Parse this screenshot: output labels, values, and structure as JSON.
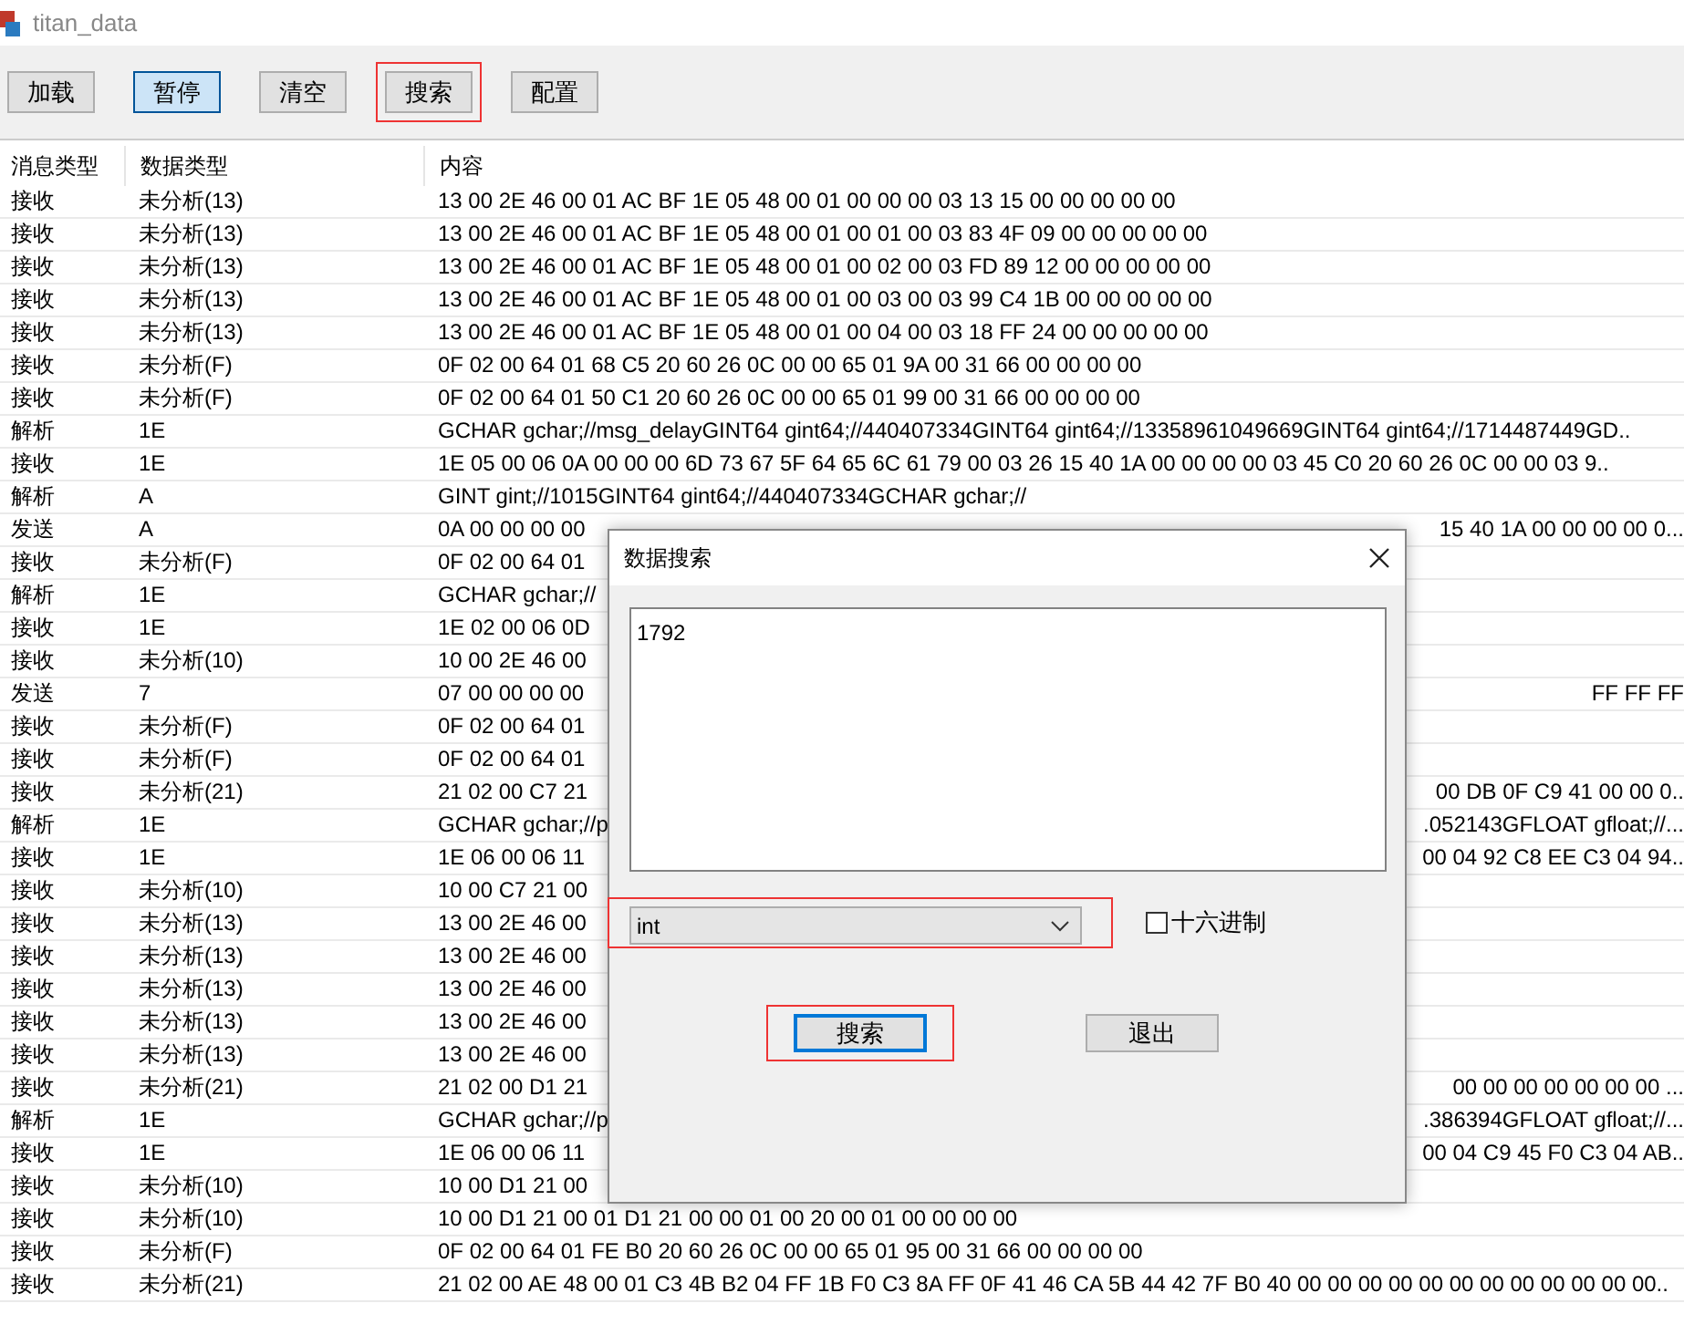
{
  "window": {
    "title": "titan_data"
  },
  "toolbar": [
    {
      "label": "加载",
      "active": false,
      "highlighted": false
    },
    {
      "label": "暂停",
      "active": true,
      "highlighted": false
    },
    {
      "label": "清空",
      "active": false,
      "highlighted": false
    },
    {
      "label": "搜索",
      "active": false,
      "highlighted": true
    },
    {
      "label": "配置",
      "active": false,
      "highlighted": false
    }
  ],
  "table": {
    "columns": [
      "消息类型",
      "数据类型",
      "内容"
    ],
    "rows": [
      {
        "message_type": "接收",
        "data_type": "未分析(13)",
        "content": "13 00 2E 46 00 01 AC BF 1E 05 48 00 01 00 00 00 03 13 15 00 00 00 00 00"
      },
      {
        "message_type": "接收",
        "data_type": "未分析(13)",
        "content": "13 00 2E 46 00 01 AC BF 1E 05 48 00 01 00 01 00 03 83 4F 09 00 00 00 00 00"
      },
      {
        "message_type": "接收",
        "data_type": "未分析(13)",
        "content": "13 00 2E 46 00 01 AC BF 1E 05 48 00 01 00 02 00 03 FD 89 12 00 00 00 00 00"
      },
      {
        "message_type": "接收",
        "data_type": "未分析(13)",
        "content": "13 00 2E 46 00 01 AC BF 1E 05 48 00 01 00 03 00 03 99 C4 1B 00 00 00 00 00"
      },
      {
        "message_type": "接收",
        "data_type": "未分析(13)",
        "content": "13 00 2E 46 00 01 AC BF 1E 05 48 00 01 00 04 00 03 18 FF 24 00 00 00 00 00"
      },
      {
        "message_type": "接收",
        "data_type": "未分析(F)",
        "content": "0F 02 00 64 01 68 C5 20 60 26 0C 00 00 65 01 9A 00 31 66 00 00 00 00"
      },
      {
        "message_type": "接收",
        "data_type": "未分析(F)",
        "content": "0F 02 00 64 01 50 C1 20 60 26 0C 00 00 65 01 99 00 31 66 00 00 00 00"
      },
      {
        "message_type": "解析",
        "data_type": "1E",
        "content": "GCHAR gchar;//msg_delayGINT64 gint64;//440407334GINT64 gint64;//13358961049669GINT64 gint64;//1714487449GD.."
      },
      {
        "message_type": "接收",
        "data_type": "1E",
        "content": "1E 05 00 06 0A 00 00 00 6D 73 67 5F 64 65 6C 61 79 00 03 26 15 40 1A 00 00 00 00 03 45 C0 20 60 26 0C 00 00 03 9.."
      },
      {
        "message_type": "解析",
        "data_type": "A",
        "content": "GINT gint;//1015GINT64 gint64;//440407334GCHAR gchar;//"
      },
      {
        "message_type": "发送",
        "data_type": "A",
        "content": "0A 00 00 00 00",
        "content_right": "15 40 1A 00 00 00 00 0..."
      },
      {
        "message_type": "接收",
        "data_type": "未分析(F)",
        "content": "0F 02 00 64 01"
      },
      {
        "message_type": "解析",
        "data_type": "1E",
        "content": "GCHAR gchar;//"
      },
      {
        "message_type": "接收",
        "data_type": "1E",
        "content": "1E 02 00 06 0D"
      },
      {
        "message_type": "接收",
        "data_type": "未分析(10)",
        "content": "10 00 2E 46 00"
      },
      {
        "message_type": "发送",
        "data_type": "7",
        "content": "07 00 00 00 00",
        "content_right": "FF FF FF"
      },
      {
        "message_type": "接收",
        "data_type": "未分析(F)",
        "content": "0F 02 00 64 01"
      },
      {
        "message_type": "接收",
        "data_type": "未分析(F)",
        "content": "0F 02 00 64 01"
      },
      {
        "message_type": "接收",
        "data_type": "未分析(21)",
        "content": "21 02 00 C7 21",
        "content_right": "00 DB 0F C9 41 00 00 0.."
      },
      {
        "message_type": "解析",
        "data_type": "1E",
        "content": "GCHAR gchar;//p",
        "content_right": ".052143GFLOAT gfloat;//..."
      },
      {
        "message_type": "接收",
        "data_type": "1E",
        "content": "1E 06 00 06 11",
        "content_right": "00 04 92 C8 EE C3 04 94.."
      },
      {
        "message_type": "接收",
        "data_type": "未分析(10)",
        "content": "10 00 C7 21 00"
      },
      {
        "message_type": "接收",
        "data_type": "未分析(13)",
        "content": "13 00 2E 46 00"
      },
      {
        "message_type": "接收",
        "data_type": "未分析(13)",
        "content": "13 00 2E 46 00"
      },
      {
        "message_type": "接收",
        "data_type": "未分析(13)",
        "content": "13 00 2E 46 00"
      },
      {
        "message_type": "接收",
        "data_type": "未分析(13)",
        "content": "13 00 2E 46 00"
      },
      {
        "message_type": "接收",
        "data_type": "未分析(13)",
        "content": "13 00 2E 46 00"
      },
      {
        "message_type": "接收",
        "data_type": "未分析(21)",
        "content": "21 02 00 D1 21",
        "content_right": "00 00 00 00 00 00 00 ..."
      },
      {
        "message_type": "解析",
        "data_type": "1E",
        "content": "GCHAR gchar;//p",
        "content_right": ".386394GFLOAT gfloat;//..."
      },
      {
        "message_type": "接收",
        "data_type": "1E",
        "content": "1E 06 00 06 11",
        "content_right": "00 04 C9 45 F0 C3 04 AB.."
      },
      {
        "message_type": "接收",
        "data_type": "未分析(10)",
        "content": "10 00 D1 21 00"
      },
      {
        "message_type": "接收",
        "data_type": "未分析(10)",
        "content": "10 00 D1 21 00 01 D1 21 00 00 01 00 20 00 01 00 00 00 00"
      },
      {
        "message_type": "接收",
        "data_type": "未分析(F)",
        "content": "0F 02 00 64 01 FE B0 20 60 26 0C 00 00 65 01 95 00 31 66 00 00 00 00"
      },
      {
        "message_type": "接收",
        "data_type": "未分析(21)",
        "content": "21 02 00 AE 48 00 01 C3 4B B2 04 FF 1B F0 C3 8A FF 0F 41 46 CA 5B 44 42 7F B0 40 00 00 00 00 00 00 00 00 00 00 00 00.."
      }
    ]
  },
  "dialog": {
    "title": "数据搜索",
    "query": "1792",
    "type_select": {
      "value": "int",
      "highlighted": true
    },
    "hex_checkbox": {
      "label": "十六进制",
      "checked": false
    },
    "buttons": [
      {
        "label": "搜索",
        "focused": true,
        "highlighted": true
      },
      {
        "label": "退出",
        "focused": false,
        "highlighted": false
      }
    ]
  }
}
